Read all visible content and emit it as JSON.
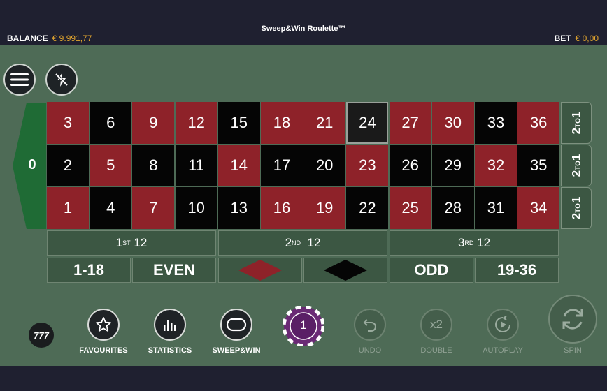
{
  "header": {
    "title": "Sweep&Win Roulette™",
    "balance_label": "BALANCE",
    "balance_value": "€ 9.991,77",
    "bet_label": "BET",
    "bet_value": "€ 0,00"
  },
  "controls": {
    "menu_icon": "hamburger-menu-icon",
    "turbo_icon": "lightning-off-icon"
  },
  "table": {
    "zero": "0",
    "rows": [
      [
        {
          "n": "3",
          "c": "red"
        },
        {
          "n": "6",
          "c": "black"
        },
        {
          "n": "9",
          "c": "red"
        },
        {
          "n": "12",
          "c": "red"
        },
        {
          "n": "15",
          "c": "black"
        },
        {
          "n": "18",
          "c": "red"
        },
        {
          "n": "21",
          "c": "red"
        },
        {
          "n": "24",
          "c": "black"
        },
        {
          "n": "27",
          "c": "red"
        },
        {
          "n": "30",
          "c": "red"
        },
        {
          "n": "33",
          "c": "black"
        },
        {
          "n": "36",
          "c": "red"
        }
      ],
      [
        {
          "n": "2",
          "c": "black"
        },
        {
          "n": "5",
          "c": "red"
        },
        {
          "n": "8",
          "c": "black"
        },
        {
          "n": "11",
          "c": "black"
        },
        {
          "n": "14",
          "c": "red"
        },
        {
          "n": "17",
          "c": "black"
        },
        {
          "n": "20",
          "c": "black"
        },
        {
          "n": "23",
          "c": "red"
        },
        {
          "n": "26",
          "c": "black"
        },
        {
          "n": "29",
          "c": "black"
        },
        {
          "n": "32",
          "c": "red"
        },
        {
          "n": "35",
          "c": "black"
        }
      ],
      [
        {
          "n": "1",
          "c": "red"
        },
        {
          "n": "4",
          "c": "black"
        },
        {
          "n": "7",
          "c": "red"
        },
        {
          "n": "10",
          "c": "black"
        },
        {
          "n": "13",
          "c": "black"
        },
        {
          "n": "16",
          "c": "red"
        },
        {
          "n": "19",
          "c": "red"
        },
        {
          "n": "22",
          "c": "black"
        },
        {
          "n": "25",
          "c": "red"
        },
        {
          "n": "28",
          "c": "black"
        },
        {
          "n": "31",
          "c": "black"
        },
        {
          "n": "34",
          "c": "red"
        }
      ]
    ],
    "column_bet": {
      "main": "2",
      "to": "TO",
      "end": "1"
    },
    "dozens": [
      {
        "pre": "1",
        "sup": "ST",
        "post": "12"
      },
      {
        "pre": "2",
        "sup": "ND",
        "post": "12"
      },
      {
        "pre": "3",
        "sup": "RD",
        "post": "12"
      }
    ],
    "outside": {
      "low": "1-18",
      "even": "EVEN",
      "odd": "ODD",
      "high": "19-36",
      "red_color": "#8e2229",
      "black_color": "#050505"
    }
  },
  "toolbar": {
    "logo": "777",
    "favourites": "FAVOURITES",
    "statistics": "STATISTICS",
    "sweepwin": "SWEEP&WIN",
    "chip_value": "1",
    "undo": "UNDO",
    "double": "DOUBLE",
    "double_icon_text": "x2",
    "autoplay": "AUTOPLAY",
    "spin": "SPIN"
  },
  "colors": {
    "felt": "#4e6b56",
    "bar": "#1f2030",
    "accent": "#e2a52e",
    "chip": "#6a2a75"
  }
}
